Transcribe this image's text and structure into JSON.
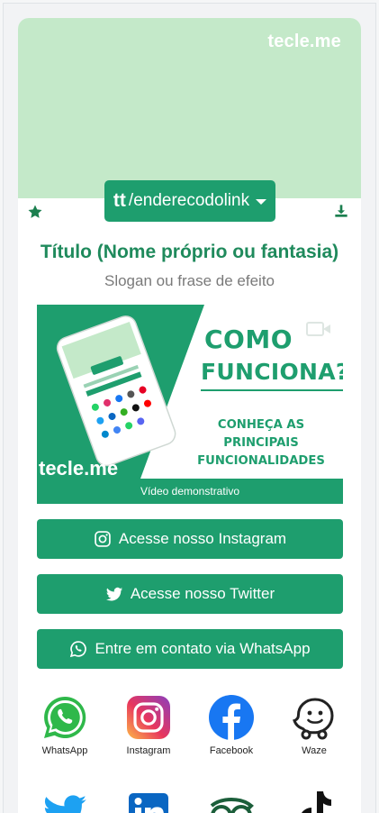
{
  "brand": "tecle.me",
  "link_button": {
    "icon_text": "tt",
    "label": "/enderecodolink"
  },
  "profile": {
    "title": "Título (Nome próprio ou fantasia)",
    "slogan": "Slogan ou frase de efeito"
  },
  "video": {
    "headline1": "COMO",
    "headline2": "FUNCIONA?",
    "subline": "CONHEÇA AS PRINCIPAIS FUNCIONALIDADES",
    "logo": "tecle.me",
    "caption": "Vídeo demonstrativo"
  },
  "buttons": [
    {
      "label": "Acesse nosso Instagram",
      "icon": "instagram-icon"
    },
    {
      "label": "Acesse nosso Twitter",
      "icon": "twitter-icon"
    },
    {
      "label": "Entre em contato via WhatsApp",
      "icon": "whatsapp-icon"
    }
  ],
  "social_icons": [
    {
      "label": "WhatsApp",
      "icon": "whatsapp-icon"
    },
    {
      "label": "Instagram",
      "icon": "instagram-icon"
    },
    {
      "label": "Facebook",
      "icon": "facebook-icon"
    },
    {
      "label": "Waze",
      "icon": "waze-icon"
    }
  ],
  "social_icons_row2": [
    "twitter-icon",
    "linkedin-icon",
    "tripadvisor-icon",
    "tiktok-icon"
  ],
  "colors": {
    "primary": "#1e9e6e",
    "cover": "#c4e9c9",
    "title": "#1f8a5c"
  }
}
